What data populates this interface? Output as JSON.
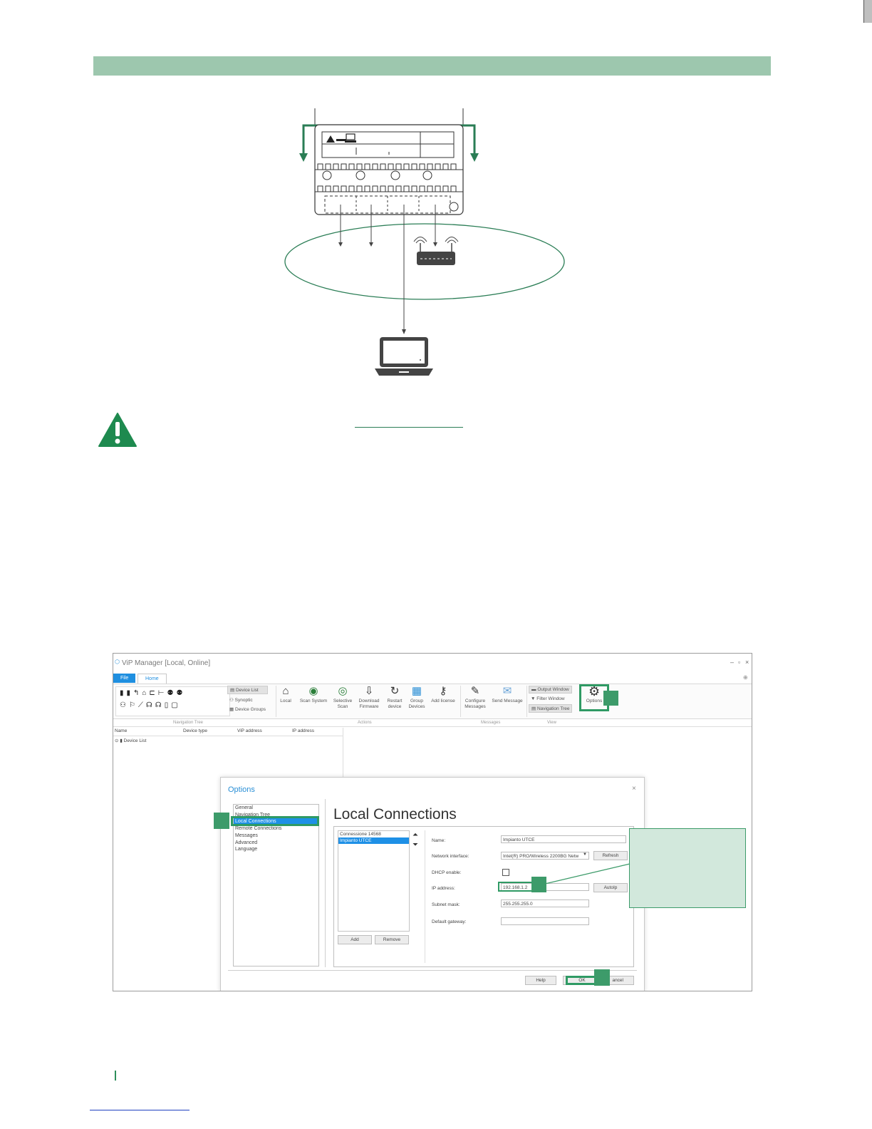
{
  "colors": {
    "accent": "#2a7d55",
    "header_bar": "#9dc7ae",
    "warning": "#1e8a4f",
    "selection": "#1e90e6"
  },
  "icons": [
    "warning-icon",
    "router-icon",
    "laptop-icon",
    "gear-icon"
  ],
  "app": {
    "window_title": "ViP Manager [Local, Online]",
    "tabs": [
      "File",
      "Home"
    ],
    "ribbon": {
      "view_list": [
        "Device List",
        "Synoptic",
        "Device Groups"
      ],
      "buttons": [
        {
          "label": "Local",
          "icon": "home-icon"
        },
        {
          "label": "Scan System",
          "icon": "globe-icon"
        },
        {
          "label": "Selective Scan",
          "icon": "globe-search-icon"
        },
        {
          "label": "Download Firmware",
          "icon": "download-icon"
        },
        {
          "label": "Restart device",
          "icon": "refresh-icon"
        },
        {
          "label": "Group Devices",
          "icon": "group-icon"
        },
        {
          "label": "Add license",
          "icon": "key-icon"
        },
        {
          "label": "Configure Messages",
          "icon": "wand-icon"
        },
        {
          "label": "Send Message",
          "icon": "mail-icon"
        }
      ],
      "window_list": [
        "Output Window",
        "Filter Window",
        "Navigation Tree"
      ],
      "options_label": "Options",
      "groups": [
        "Navigation Tree",
        "Actions",
        "Messages",
        "View"
      ]
    },
    "nav_columns": [
      "Name",
      "Device type",
      "ViP address",
      "IP address"
    ],
    "tree_root": "Device List"
  },
  "dialog": {
    "title": "Options",
    "close": "×",
    "categories": [
      "General",
      "Navigation Tree",
      "Local Connections",
      "Remote Connections",
      "Messages",
      "Advanced",
      "Language"
    ],
    "selected_category": "Local Connections",
    "heading": "Local Connections",
    "connections": [
      "Connessione 14568",
      "Impianto UTCE"
    ],
    "selected_connection": "Impianto UTCE",
    "fields": {
      "name_label": "Name:",
      "name_value": "Impianto UTCE",
      "network_label": "Network interface:",
      "network_value": "Intel(R) PRO/Wireless 2200BG Netw",
      "dhcp_label": "DHCP enable:",
      "ip_label": "IP address:",
      "ip_value": "192.168.1.2",
      "subnet_label": "Subnet mask:",
      "subnet_value": "255.255.255.0",
      "gateway_label": "Default gateway:",
      "gateway_value": ""
    },
    "buttons": {
      "refresh": "Refresh",
      "autoip": "AutoIp",
      "add": "Add",
      "remove": "Remove",
      "help": "Help",
      "ok": "OK",
      "cancel": "ancel"
    }
  }
}
